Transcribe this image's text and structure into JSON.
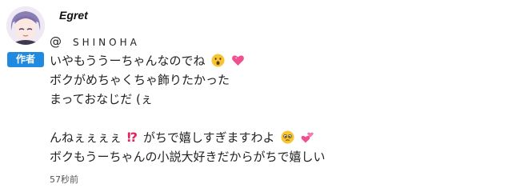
{
  "comment": {
    "username": "Egret",
    "author_badge": "作者",
    "mention_at": "@",
    "mention_name": "SHINOHA",
    "lines": [
      "いやもううーちゃんなのでね",
      "ボクがめちゃくちゃ飾りたかった",
      "まっておなじだ (ぇ",
      "",
      "んねぇぇぇぇ",
      "がちで嬉しすぎますわよ",
      "ボクもうーちゃんの小説大好きだからがちで嬉しい"
    ],
    "interrobang": "⁉",
    "timestamp": "57秒前",
    "icons": {
      "avatar": "avatar-purple-hair",
      "line1_emoji_1": "astonished-face-icon",
      "line1_emoji_2": "sparkling-heart-icon",
      "line5_emoji_1": "pleading-face-icon",
      "line5_emoji_2": "two-hearts-icon"
    },
    "colors": {
      "badge": "#1f8ae0",
      "interrobang": "#e0245e"
    }
  }
}
